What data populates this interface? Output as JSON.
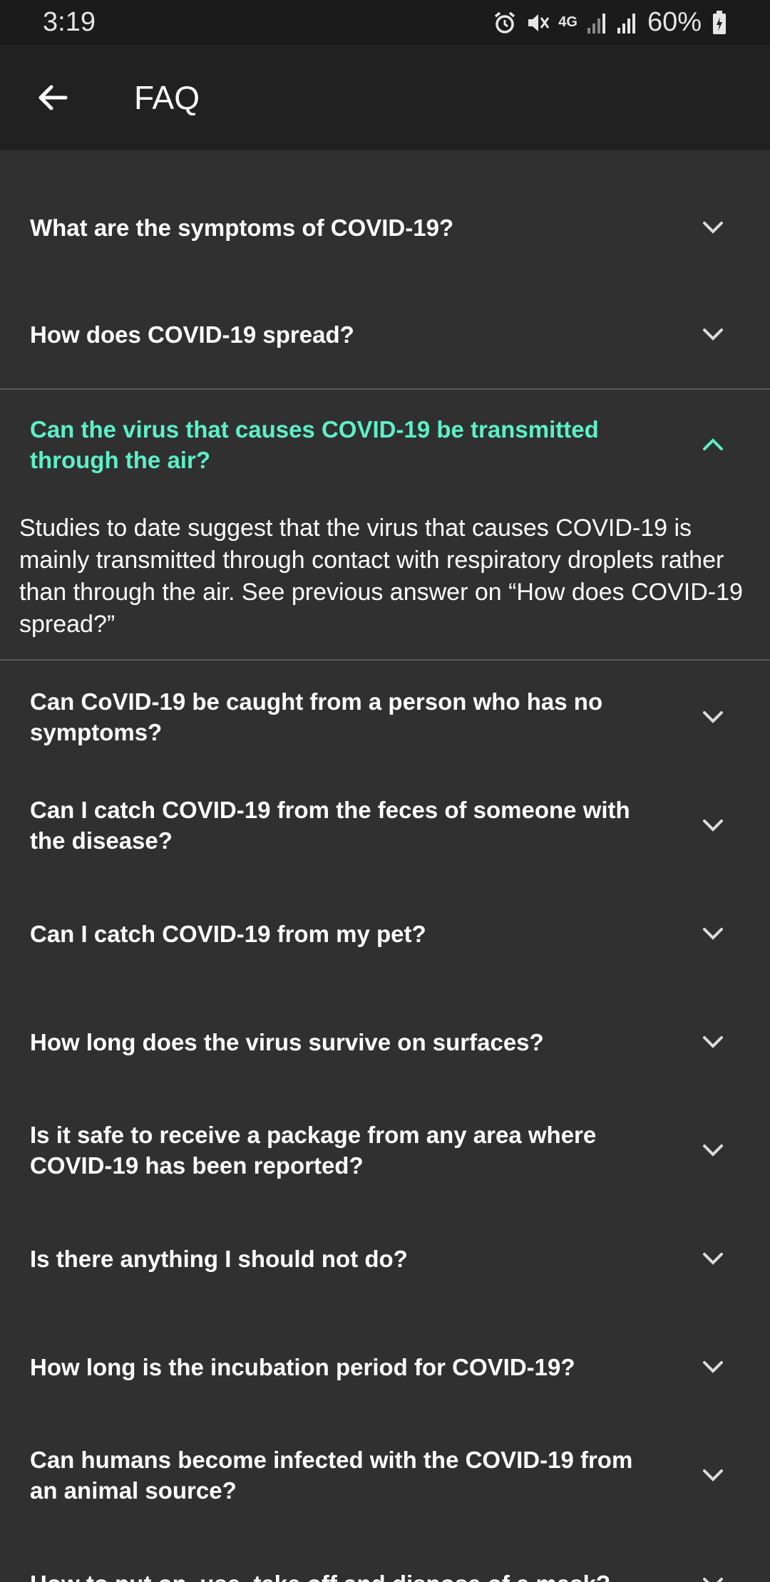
{
  "status_bar": {
    "time": "3:19",
    "network": "4G",
    "battery": "60%",
    "icons": [
      "alarm-icon",
      "mute-icon",
      "data-icon",
      "signal-icon",
      "signal-icon",
      "battery-icon"
    ]
  },
  "app_bar": {
    "title": "FAQ",
    "back_icon": "back-arrow-icon"
  },
  "colors": {
    "background": "#303030",
    "app_bar": "#212121",
    "status_bar": "#1b1b1c",
    "accent": "#5cf0c8"
  },
  "faq": [
    {
      "question": "What are the symptoms of COVID-19?",
      "expanded": false
    },
    {
      "question": "How does COVID-19 spread?",
      "expanded": false
    },
    {
      "question": "Can the virus that causes COVID-19 be transmitted through the air?",
      "expanded": true,
      "answer": "Studies to date suggest that the virus that causes COVID-19 is mainly transmitted through contact with respiratory droplets rather than through the air. See previous answer on “How does COVID-19 spread?”"
    },
    {
      "question": "Can CoVID-19 be caught from a person who has no symptoms?",
      "expanded": false
    },
    {
      "question": "Can I catch COVID-19 from the feces of someone with the disease?",
      "expanded": false
    },
    {
      "question": "Can I catch COVID-19 from my pet?",
      "expanded": false
    },
    {
      "question": "How long does the virus survive on surfaces?",
      "expanded": false
    },
    {
      "question": "Is it safe to receive a package from any area where COVID-19 has been reported?",
      "expanded": false
    },
    {
      "question": "Is there anything I should not do?",
      "expanded": false
    },
    {
      "question": "How long is the incubation period for COVID-19?",
      "expanded": false
    },
    {
      "question": "Can humans become infected with the COVID-19 from an animal source?",
      "expanded": false
    },
    {
      "question": "How to put on, use, take off and dispose of a mask?",
      "expanded": false
    }
  ]
}
